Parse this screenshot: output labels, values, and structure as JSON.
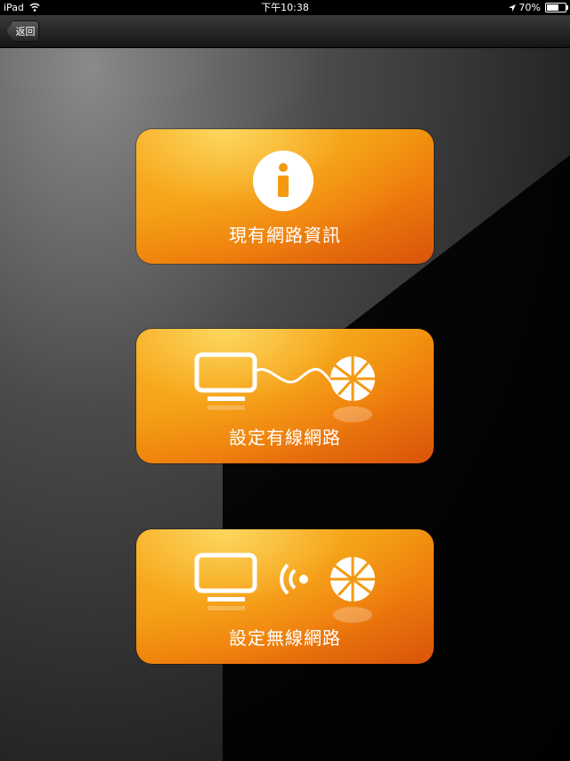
{
  "status_bar": {
    "device": "iPad",
    "time": "下午10:38",
    "battery": "70%",
    "battery_level": 0.7
  },
  "nav": {
    "back_label": "返回"
  },
  "menu": {
    "items": [
      {
        "label": "現有網路資訊",
        "icon": "info-icon"
      },
      {
        "label": "設定有線網路",
        "icon": "wired-network-icon"
      },
      {
        "label": "設定無線網路",
        "icon": "wireless-network-icon"
      }
    ]
  },
  "colors": {
    "accent": "#f39a12",
    "accent_dark": "#d9530b"
  }
}
